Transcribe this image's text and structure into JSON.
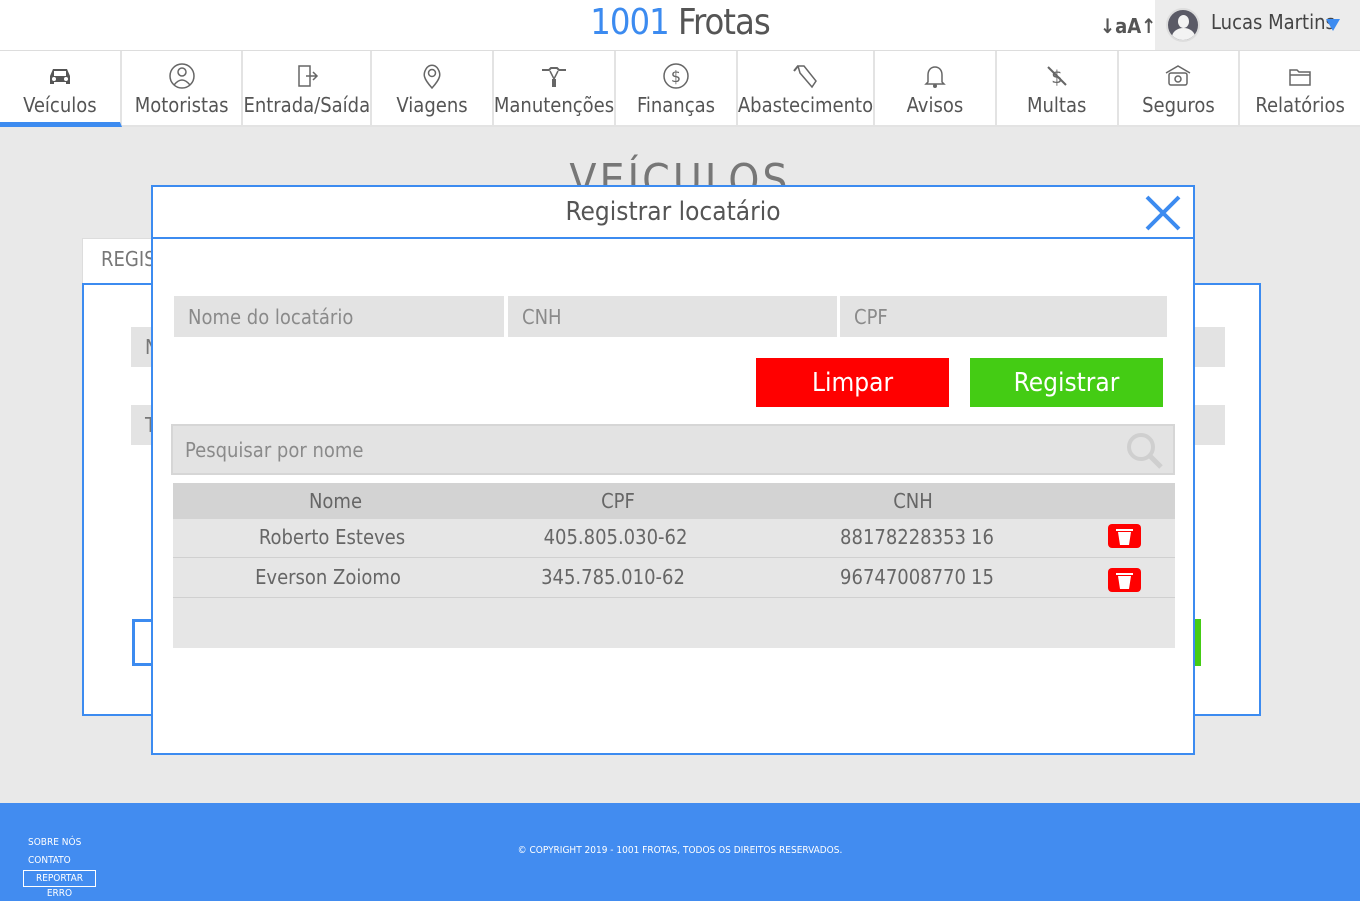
{
  "header": {
    "logo_number": "1001",
    "logo_name": "Frotas",
    "font_size_toggle": "↓aA↑",
    "user_name": "Lucas Martins"
  },
  "nav": {
    "items": [
      {
        "label": "Veículos",
        "icon": "car-icon",
        "active": true
      },
      {
        "label": "Motoristas",
        "icon": "driver-icon"
      },
      {
        "label": "Entrada/Saída",
        "icon": "door-icon"
      },
      {
        "label": "Viagens",
        "icon": "map-pin-icon"
      },
      {
        "label": "Manutenções",
        "icon": "wrench-icon"
      },
      {
        "label": "Finanças",
        "icon": "dollar-icon"
      },
      {
        "label": "Abastecimento",
        "icon": "fuel-icon"
      },
      {
        "label": "Avisos",
        "icon": "bell-icon"
      },
      {
        "label": "Multas",
        "icon": "fine-icon"
      },
      {
        "label": "Seguros",
        "icon": "insurance-icon"
      },
      {
        "label": "Relatórios",
        "icon": "folder-icon"
      }
    ]
  },
  "background_page": {
    "title": "VEÍCULOS",
    "tab_label": "REGIST",
    "field1_initial": "N",
    "field2_initial": "T"
  },
  "modal": {
    "title": "Registrar locatário",
    "fields": {
      "name_placeholder": "Nome do locatário",
      "cnh_placeholder": "CNH",
      "cpf_placeholder": "CPF"
    },
    "clear_label": "Limpar",
    "register_label": "Registrar",
    "search_placeholder": "Pesquisar por nome",
    "table": {
      "headers": [
        "Nome",
        "CPF",
        "CNH"
      ],
      "rows": [
        {
          "name": "Roberto Esteves",
          "cpf": "405.805.030-62",
          "cnh": "88178228353",
          "cnh_extra": "16"
        },
        {
          "name": "Everson Zoiomo",
          "cpf": "345.785.010-62",
          "cnh": "96747008770",
          "cnh_extra": "15"
        }
      ]
    }
  },
  "footer": {
    "about": "Sobre nós",
    "contact": "Contato",
    "report": "Reportar erro",
    "copyright": "© Copyright 2019 - 1001 Frotas, todos os direitos reservados."
  },
  "colors": {
    "accent": "#3c8bf0",
    "danger": "#ff0000",
    "success": "#44cc14",
    "footer": "#428cf0"
  }
}
